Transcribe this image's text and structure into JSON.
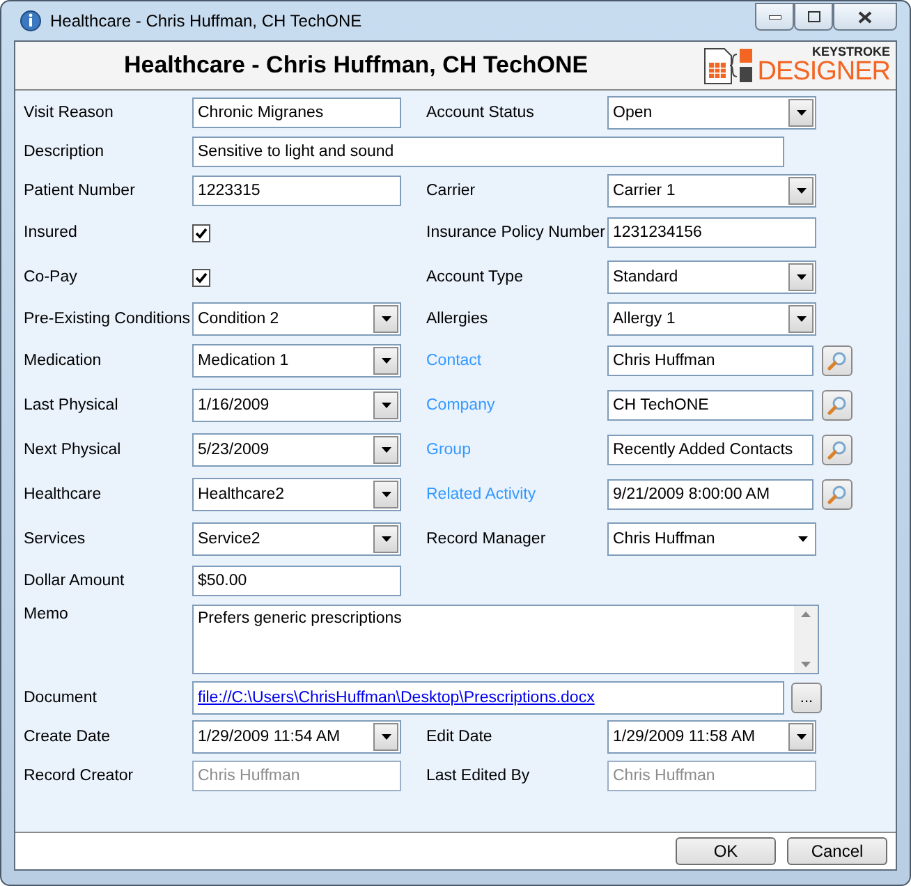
{
  "window": {
    "title": "Healthcare - Chris Huffman, CH TechONE"
  },
  "header": {
    "title": "Healthcare - Chris Huffman, CH TechONE",
    "logo_top": "KEYSTROKE",
    "logo_bottom": "DESIGNER"
  },
  "rows": [
    {
      "cells": [
        {
          "label": "Visit Reason",
          "kind": "text",
          "value": "Chronic Migranes"
        },
        {
          "label": "Account Status",
          "kind": "combo",
          "value": "Open"
        }
      ]
    },
    {
      "cells": [
        {
          "label": "Description",
          "kind": "long_text",
          "value": "Sensitive to light and sound"
        }
      ]
    },
    {
      "cells": [
        {
          "label": "Patient Number",
          "kind": "text",
          "value": "1223315"
        },
        {
          "label": "Carrier",
          "kind": "combo",
          "value": "Carrier 1"
        }
      ]
    },
    {
      "cells": [
        {
          "label": "Insured",
          "kind": "check",
          "checked": true
        },
        {
          "label": "Insurance Policy Number",
          "kind": "text",
          "value": "1231234156"
        }
      ]
    },
    {
      "cells": [
        {
          "label": "Co-Pay",
          "kind": "check",
          "checked": true
        },
        {
          "label": "Account Type",
          "kind": "combo",
          "value": "Standard"
        }
      ]
    },
    {
      "cells": [
        {
          "label": "Pre-Existing Conditions",
          "kind": "combo",
          "value": "Condition 2"
        },
        {
          "label": "Allergies",
          "kind": "combo",
          "value": "Allergy 1"
        }
      ]
    },
    {
      "cells": [
        {
          "label": "Medication",
          "kind": "combo",
          "value": "Medication 1"
        },
        {
          "label": "Contact",
          "kind": "lookup",
          "value": "Chris Huffman"
        }
      ]
    },
    {
      "cells": [
        {
          "label": "Last Physical",
          "kind": "combo",
          "value": "1/16/2009"
        },
        {
          "label": "Company",
          "kind": "lookup",
          "value": "CH TechONE"
        }
      ]
    },
    {
      "cells": [
        {
          "label": "Next Physical",
          "kind": "combo",
          "value": "5/23/2009"
        },
        {
          "label": "Group",
          "kind": "lookup",
          "value": "Recently Added Contacts"
        }
      ]
    },
    {
      "cells": [
        {
          "label": "Healthcare",
          "kind": "combo",
          "value": "Healthcare2"
        },
        {
          "label": "Related Activity",
          "kind": "lookup",
          "value": "9/21/2009 8:00:00 AM"
        }
      ]
    },
    {
      "cells": [
        {
          "label": "Services",
          "kind": "combo",
          "value": "Service2"
        },
        {
          "label": "Record Manager",
          "kind": "flat_combo",
          "value": "Chris Huffman"
        }
      ]
    },
    {
      "cells": [
        {
          "label": "Dollar Amount",
          "kind": "text",
          "value": "$50.00"
        }
      ]
    },
    {
      "cells": [
        {
          "label": "Memo",
          "kind": "memo",
          "value": "Prefers generic prescriptions"
        }
      ]
    },
    {
      "cells": [
        {
          "label": "Document",
          "kind": "document",
          "value": "file://C:\\Users\\ChrisHuffman\\Desktop\\Prescriptions.docx",
          "browse": "..."
        }
      ]
    },
    {
      "cells": [
        {
          "label": "Create Date",
          "kind": "combo",
          "value": "1/29/2009 11:54 AM"
        },
        {
          "label": "Edit Date",
          "kind": "combo",
          "value": "1/29/2009 11:58 AM"
        }
      ]
    },
    {
      "cells": [
        {
          "label": "Record Creator",
          "kind": "text",
          "disabled": true,
          "value": "Chris Huffman"
        },
        {
          "label": "Last Edited By",
          "kind": "text",
          "disabled": true,
          "value": "Chris Huffman"
        }
      ]
    }
  ],
  "buttons": [
    "OK",
    "Cancel"
  ]
}
